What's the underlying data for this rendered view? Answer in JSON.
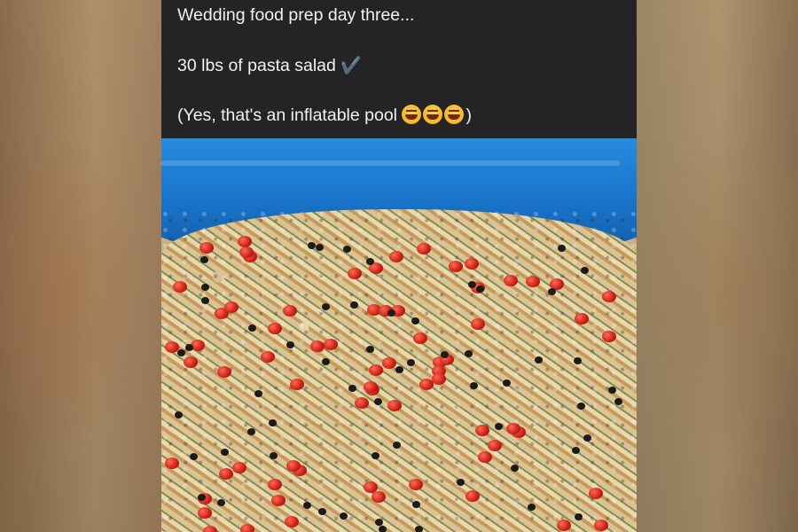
{
  "post": {
    "caption_line1": "Wedding food prep day three...",
    "caption_line2": "30 lbs of pasta salad",
    "caption_line2_icon": "check-mark-icon",
    "caption_line3_prefix": "(Yes, that's an inflatable pool ",
    "caption_line3_suffix": ")",
    "emoji_icon": "rolling-on-floor-laughing-emoji",
    "emoji_count": 3
  },
  "colors": {
    "caption_background": "#242427",
    "caption_text": "#f2f2f2",
    "pool_blue": "#1a78cf"
  }
}
